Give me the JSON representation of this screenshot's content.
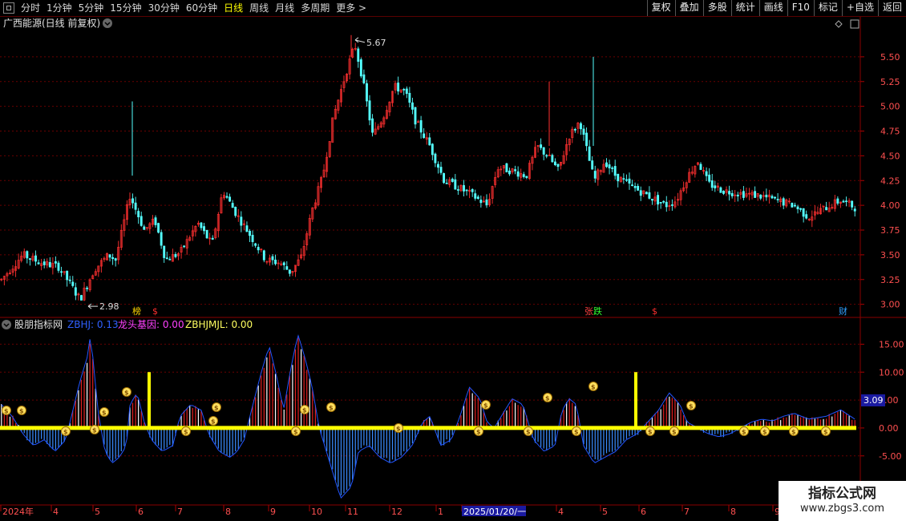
{
  "toolbar": {
    "periods": [
      "分时",
      "1分钟",
      "5分钟",
      "15分钟",
      "30分钟",
      "60分钟",
      "日线",
      "周线",
      "月线",
      "多周期",
      "更多 >"
    ],
    "active_period": "日线",
    "buttons": [
      "复权",
      "叠加",
      "多股",
      "统计",
      "画线",
      "F10",
      "标记",
      "+自选",
      "返回"
    ]
  },
  "main_panel": {
    "title": "广西能源(日线 前复权)",
    "high_label": "5.67",
    "low_label": "2.98",
    "y_ticks": [
      "5.50",
      "5.25",
      "5.00",
      "4.75",
      "4.50",
      "4.25",
      "4.00",
      "3.75",
      "3.50",
      "3.25",
      "3.00"
    ],
    "markers": [
      {
        "text": "榜",
        "color": "#ffd700"
      },
      {
        "text": "$",
        "color": "#ff3030"
      },
      {
        "text": "张",
        "color": "#ff4040"
      },
      {
        "text": "跌",
        "color": "#30ff30"
      },
      {
        "text": "$",
        "color": "#ff3030"
      },
      {
        "text": "财",
        "color": "#30a0ff"
      }
    ]
  },
  "indicator_panel": {
    "name": "股朋指标网",
    "legend": [
      {
        "label": "ZBHJ: 0.13",
        "color": "#3060ff"
      },
      {
        "label": "龙头基因: 0.00",
        "color": "#ff40ff"
      },
      {
        "label": "ZBHJMJL: 0.00",
        "color": "#ffff60"
      }
    ],
    "y_ticks": [
      "15.00",
      "10.00",
      "5.00",
      "0.00",
      "-5.00"
    ],
    "current_value": "3.09"
  },
  "x_axis": {
    "labels": [
      "2024年",
      "4",
      "5",
      "6",
      "7",
      "8",
      "9",
      "10",
      "11",
      "12",
      "1",
      "2025/01/20/一",
      "4",
      "5",
      "6",
      "7",
      "8",
      "9"
    ]
  },
  "chart_data": {
    "type": "candlestick",
    "y_range": [
      2.9,
      5.75
    ],
    "bars": 300,
    "high": 5.67,
    "low": 2.98,
    "indicator_range": [
      -13.5,
      17.5
    ]
  },
  "colors": {
    "up": "#ff3030",
    "down": "#54ffff",
    "grid": "#6a0000",
    "axis_text": "#ff5050",
    "indicator_pos": "#e02020",
    "indicator_neg": "#3a8cff",
    "baseline": "#ffff00"
  },
  "watermark": {
    "line1": "指标公式网",
    "line2": "www.zbgs3.com"
  }
}
